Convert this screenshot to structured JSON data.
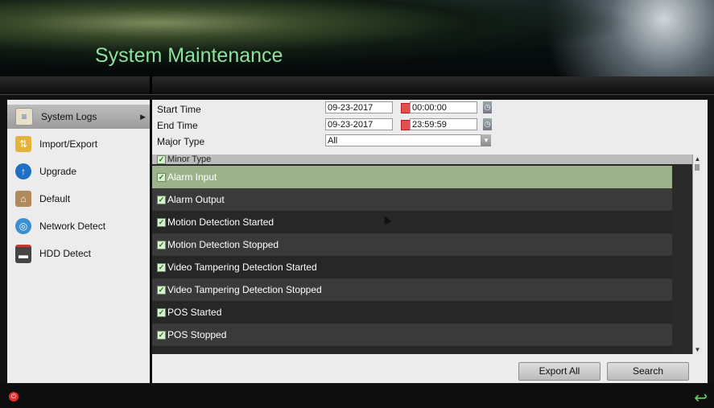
{
  "header": {
    "title": "System Maintenance"
  },
  "sidebar": {
    "items": [
      {
        "label": "System Logs",
        "icon": "system-logs-icon",
        "active": true
      },
      {
        "label": "Import/Export",
        "icon": "import-export-icon"
      },
      {
        "label": "Upgrade",
        "icon": "upgrade-icon"
      },
      {
        "label": "Default",
        "icon": "default-icon"
      },
      {
        "label": "Network Detect",
        "icon": "network-detect-icon"
      },
      {
        "label": "HDD Detect",
        "icon": "hdd-detect-icon"
      }
    ]
  },
  "filters": {
    "start_time_label": "Start Time",
    "start_date": "09-23-2017",
    "start_time": "00:00:00",
    "end_time_label": "End Time",
    "end_date": "09-23-2017",
    "end_time": "23:59:59",
    "major_type_label": "Major Type",
    "major_type_value": "All"
  },
  "minor_type": {
    "header": "Minor Type",
    "items": [
      "Alarm Input",
      "Alarm Output",
      "Motion Detection Started",
      "Motion Detection Stopped",
      "Video Tampering Detection Started",
      "Video Tampering Detection Stopped",
      "POS Started",
      "POS Stopped"
    ],
    "selected_index": 0
  },
  "buttons": {
    "export_all": "Export All",
    "search": "Search"
  },
  "colors": {
    "title": "#8ee29c",
    "selected_row": "#9bb28a"
  }
}
